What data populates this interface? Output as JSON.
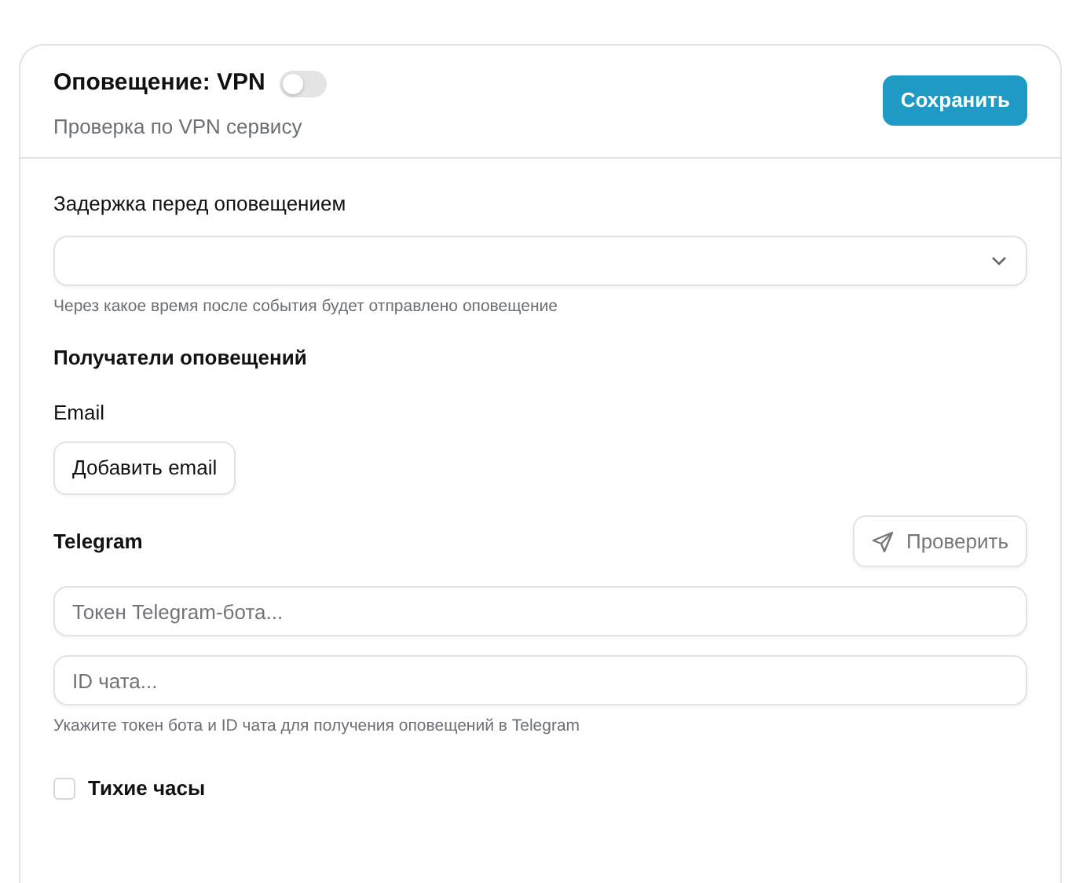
{
  "header": {
    "title": "Оповещение: VPN",
    "enabled": false,
    "subtitle": "Проверка по VPN сервису",
    "save_button": "Сохранить"
  },
  "delay": {
    "label": "Задержка перед оповещением",
    "hint": "Через какое время после события будет отправлено оповещение"
  },
  "recipients": {
    "title": "Получатели оповещений",
    "email": {
      "label": "Email",
      "add_button": "Добавить email"
    },
    "telegram": {
      "label": "Telegram",
      "check_button": {
        "label": "Проверить",
        "disabled": true
      },
      "fields": [
        {
          "placeholder": "Токен Telegram-бота..."
        },
        {
          "placeholder": "ID чата..."
        }
      ],
      "hint": "Укажите токен бота и ID чата для получения оповещений в Telegram"
    }
  },
  "quiet_hours": {
    "label": "Тихие часы",
    "checked": false
  }
}
